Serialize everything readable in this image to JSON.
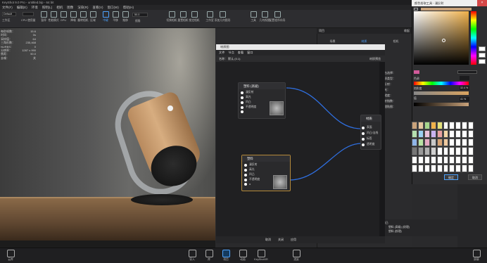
{
  "window": {
    "title": "KeyShot 9.0 Pro - untitled.bip - 64 bit"
  },
  "menu": [
    "文件(F)",
    "编辑(E)",
    "环境",
    "照明(L)",
    "相机",
    "图像",
    "渲染(R)",
    "查看(V)",
    "窗口(W)",
    "帮助(H)"
  ],
  "toolbar": {
    "workspace": "Default",
    "cpu_label": "CPU 使用量",
    "items": [
      "工作区",
      "CPU 使用量",
      "暂停",
      "性能模式",
      "GPU",
      "降噪",
      "翻转相机",
      "区域",
      "中键",
      "平移",
      "推移",
      "视角",
      "",
      "切换相机",
      "重置相机",
      "锁定相机",
      "工作室",
      "添加几何图形",
      "工具",
      "几何视图",
      "配置程序向导"
    ],
    "zoom": "50.0"
  },
  "stats": [
    [
      "每秒帧数：",
      "15.6"
    ],
    [
      "时间：",
      "0s"
    ],
    [
      "采样值：",
      "64"
    ],
    [
      "三角形数：",
      "235,468"
    ],
    [
      "NURBS：",
      "0"
    ],
    [
      "分辨率：",
      "1287 x 990"
    ],
    [
      "焦距：",
      "50.0"
    ],
    [
      "去噪：",
      "关"
    ]
  ],
  "bottombar": {
    "left": "云库",
    "items": [
      "导入",
      "库",
      "项目",
      "动画",
      "KeyShotXR",
      "渲染"
    ],
    "right": "屏幕"
  },
  "rightpanel": {
    "header": "项目",
    "collapse": "收起",
    "tabs": [
      "场景",
      "材质",
      "相机",
      "环境",
      "照明",
      "图像"
    ],
    "props": [
      "单击选择：",
      "材质类型：",
      "",
      "漫反射：",
      "高光：",
      "粗糙度：",
      "折射指数：",
      "",
      "纹理贴图："
    ],
    "list_items": [
      "凹凸",
      "塑料 (高级) (纹理)",
      "塑料 (纹理)"
    ]
  },
  "node_editor": {
    "title": "材质图",
    "menu": [
      "文件",
      "节点",
      "查看",
      "窗口"
    ],
    "name_label": "名称：",
    "name_value": "默认 (0.1)",
    "preview_label": "材质预览",
    "footer": [
      "取消",
      "关闭",
      "应用"
    ],
    "nodes": [
      {
        "title": "塑料 (高级)",
        "ports": [
          "漫反射",
          "高光",
          "凹凸",
          "不透明度",
          "?"
        ]
      },
      {
        "title": "塑料",
        "ports": [
          "漫反射",
          "高光",
          "凹凸",
          "不透明度",
          "α"
        ]
      },
      {
        "title": "材质",
        "ports": [
          "表面",
          "凹凸/法线",
          "标签",
          "透明度"
        ]
      }
    ]
  },
  "picker": {
    "title": "颜色拾取工具 - 漫反射",
    "labels": [
      "色调",
      "饱和度",
      "值"
    ],
    "values": [
      "",
      "32.4 %",
      "41 %"
    ],
    "ok": "确定",
    "cancel": "取消"
  },
  "colors": {
    "accent": "#4da3ff",
    "bg": "#2a2a2c",
    "wire": "#2f6fe0",
    "picker_hue": "#f0b14a"
  }
}
